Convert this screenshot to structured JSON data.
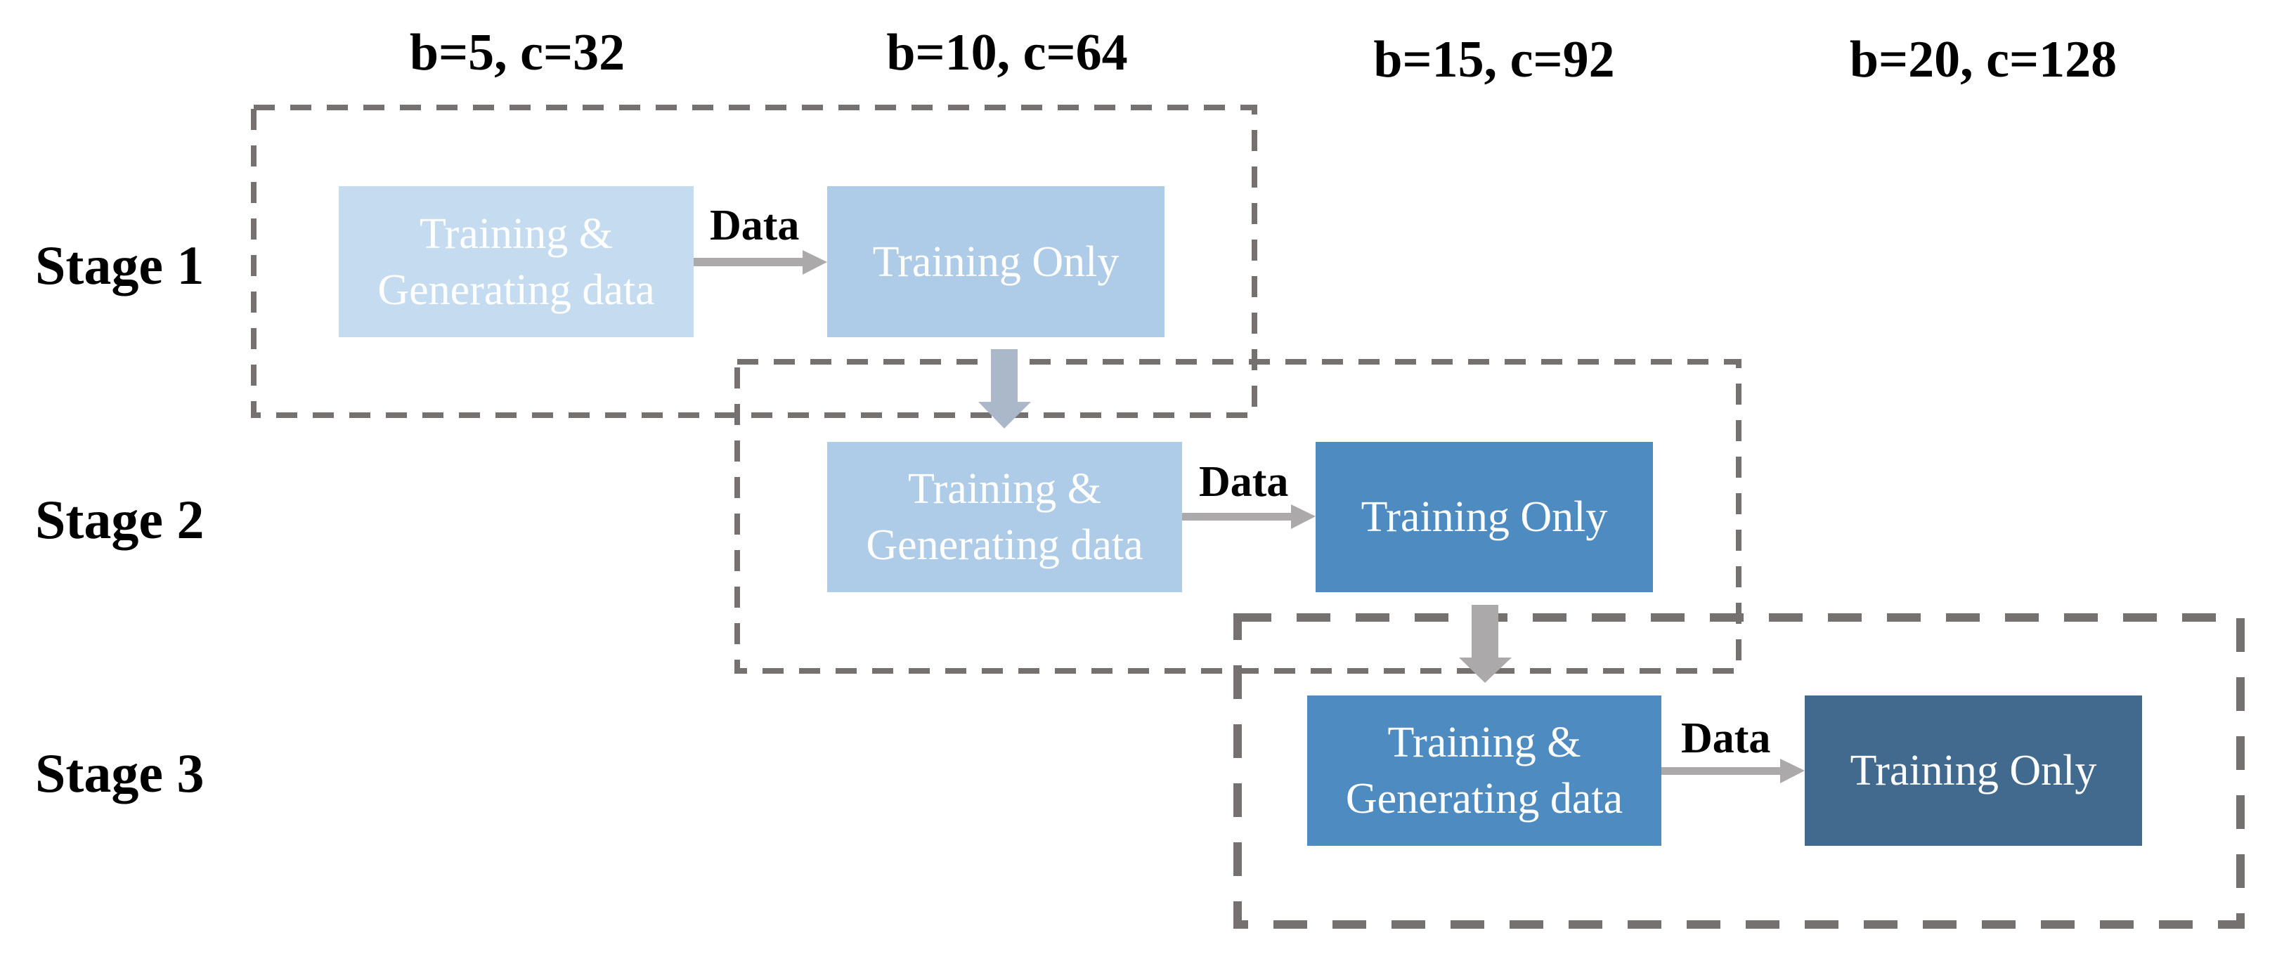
{
  "columns": [
    {
      "label": "b=5, c=32"
    },
    {
      "label": "b=10, c=64"
    },
    {
      "label": "b=15, c=92"
    },
    {
      "label": "b=20, c=128"
    }
  ],
  "stages": [
    {
      "label": "Stage 1",
      "generate_box": {
        "text": "Training &\nGenerating data",
        "color": "#C5DCF0"
      },
      "train_box": {
        "text": "Training Only",
        "color": "#AECBE8"
      },
      "arrow_label": "Data"
    },
    {
      "label": "Stage 2",
      "generate_box": {
        "text": "Training &\nGenerating data",
        "color": "#AECBE8"
      },
      "train_box": {
        "text": "Training Only",
        "color": "#4E8BC1"
      },
      "arrow_label": "Data"
    },
    {
      "label": "Stage 3",
      "generate_box": {
        "text": "Training &\nGenerating data",
        "color": "#4E8BC1"
      },
      "train_box": {
        "text": "Training Only",
        "color": "#42698E"
      },
      "arrow_label": "Data"
    }
  ],
  "colors": {
    "dash": "#767171",
    "arrow_gray": "#ABA9A9",
    "arrow_blue_gray": "#ABB8CA"
  }
}
